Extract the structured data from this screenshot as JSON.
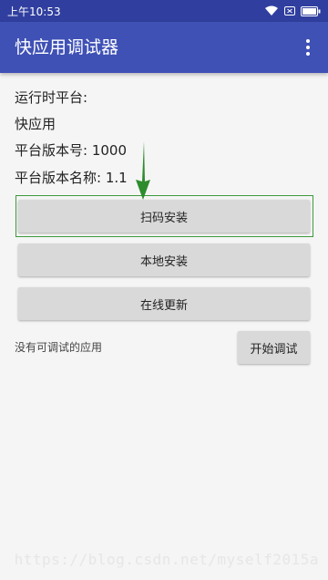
{
  "status_bar": {
    "time": "上午10:53",
    "icons": [
      "wifi-icon",
      "sim-icon",
      "battery-icon"
    ]
  },
  "app_bar": {
    "title": "快应用调试器",
    "menu_icon": "more-vert-icon"
  },
  "info": {
    "runtime_label": "运行时平台:",
    "runtime_value": "快应用",
    "version_code": "平台版本号: 1000",
    "version_name": "平台版本名称: 1.1"
  },
  "buttons": {
    "scan_install": "扫码安装",
    "local_install": "本地安装",
    "online_update": "在线更新",
    "start_debug": "开始调试"
  },
  "debug": {
    "no_app_text": "没有可调试的应用"
  },
  "annotation": {
    "arrow_color": "#2e8b2e",
    "highlight_color": "#3c9a3c"
  },
  "watermark": "https://blog.csdn.net/myself2015a",
  "colors": {
    "app_bar": "#3f51b5",
    "status_bar": "#303f9f",
    "button_bg": "#d9d9d9",
    "background": "#f5f5f5"
  }
}
